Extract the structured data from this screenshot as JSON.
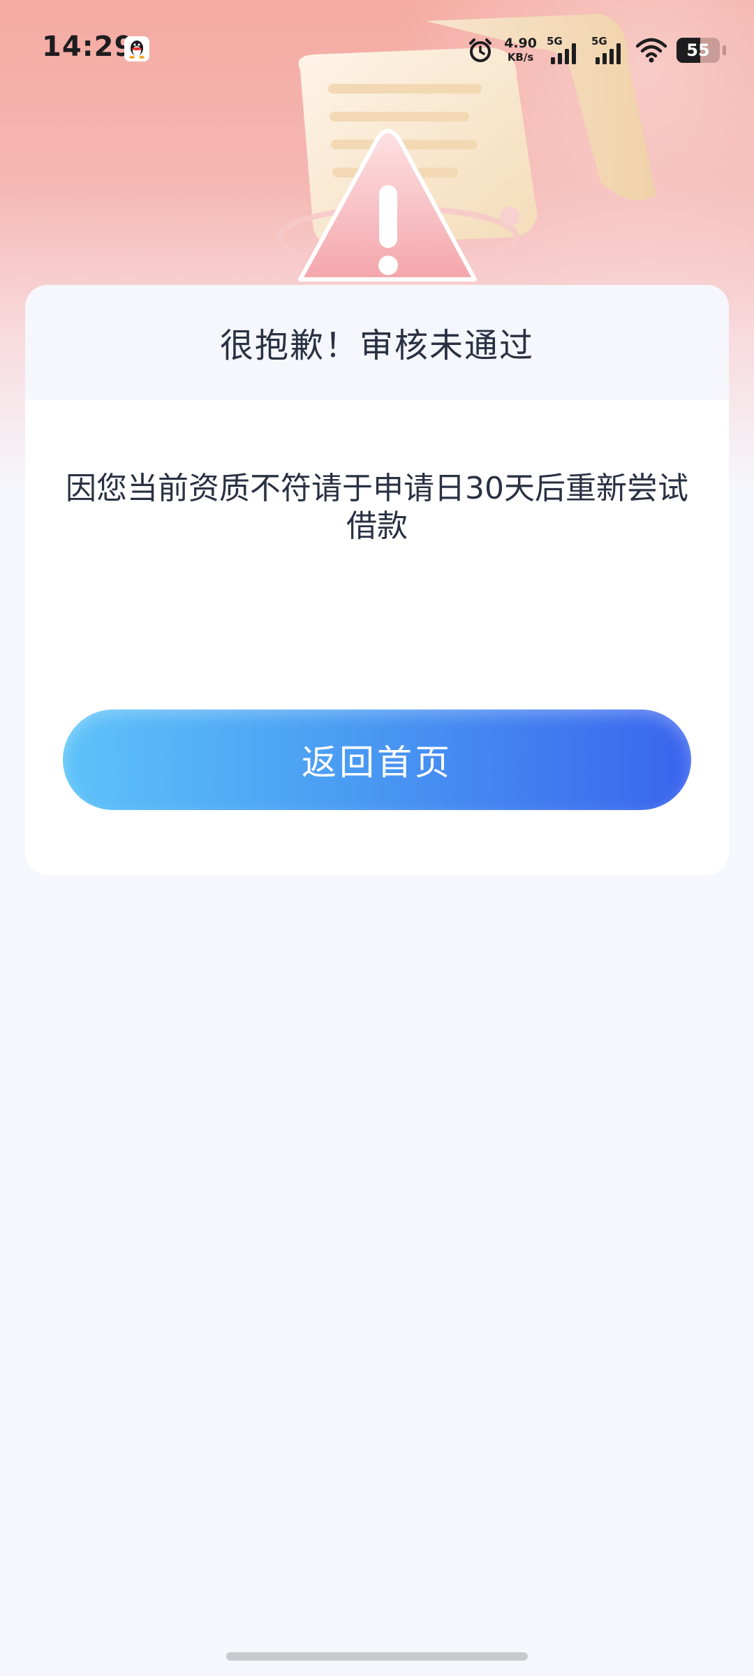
{
  "status_bar": {
    "time": "14:29",
    "network_speed": "4.90",
    "network_speed_unit": "KB/s",
    "sim1_label": "5G",
    "sim2_label": "5G",
    "battery_level": "55",
    "notification_app_icon": "qq-penguin-icon",
    "alarm_icon": "alarm-clock-icon",
    "wifi_icon": "wifi-icon"
  },
  "card": {
    "title": "很抱歉！审核未通过",
    "message": "因您当前资质不符请于申请日30天后重新尝试借款",
    "button_label": "返回首页"
  },
  "colors": {
    "button_gradient_start": "#5ec3f9",
    "button_gradient_end": "#3a64ee",
    "header_gradient_top": "#f4aba2",
    "page_background": "#f6f7fc",
    "text_primary": "#2a3143"
  },
  "illustration": {
    "icon": "warning-triangle-icon"
  }
}
